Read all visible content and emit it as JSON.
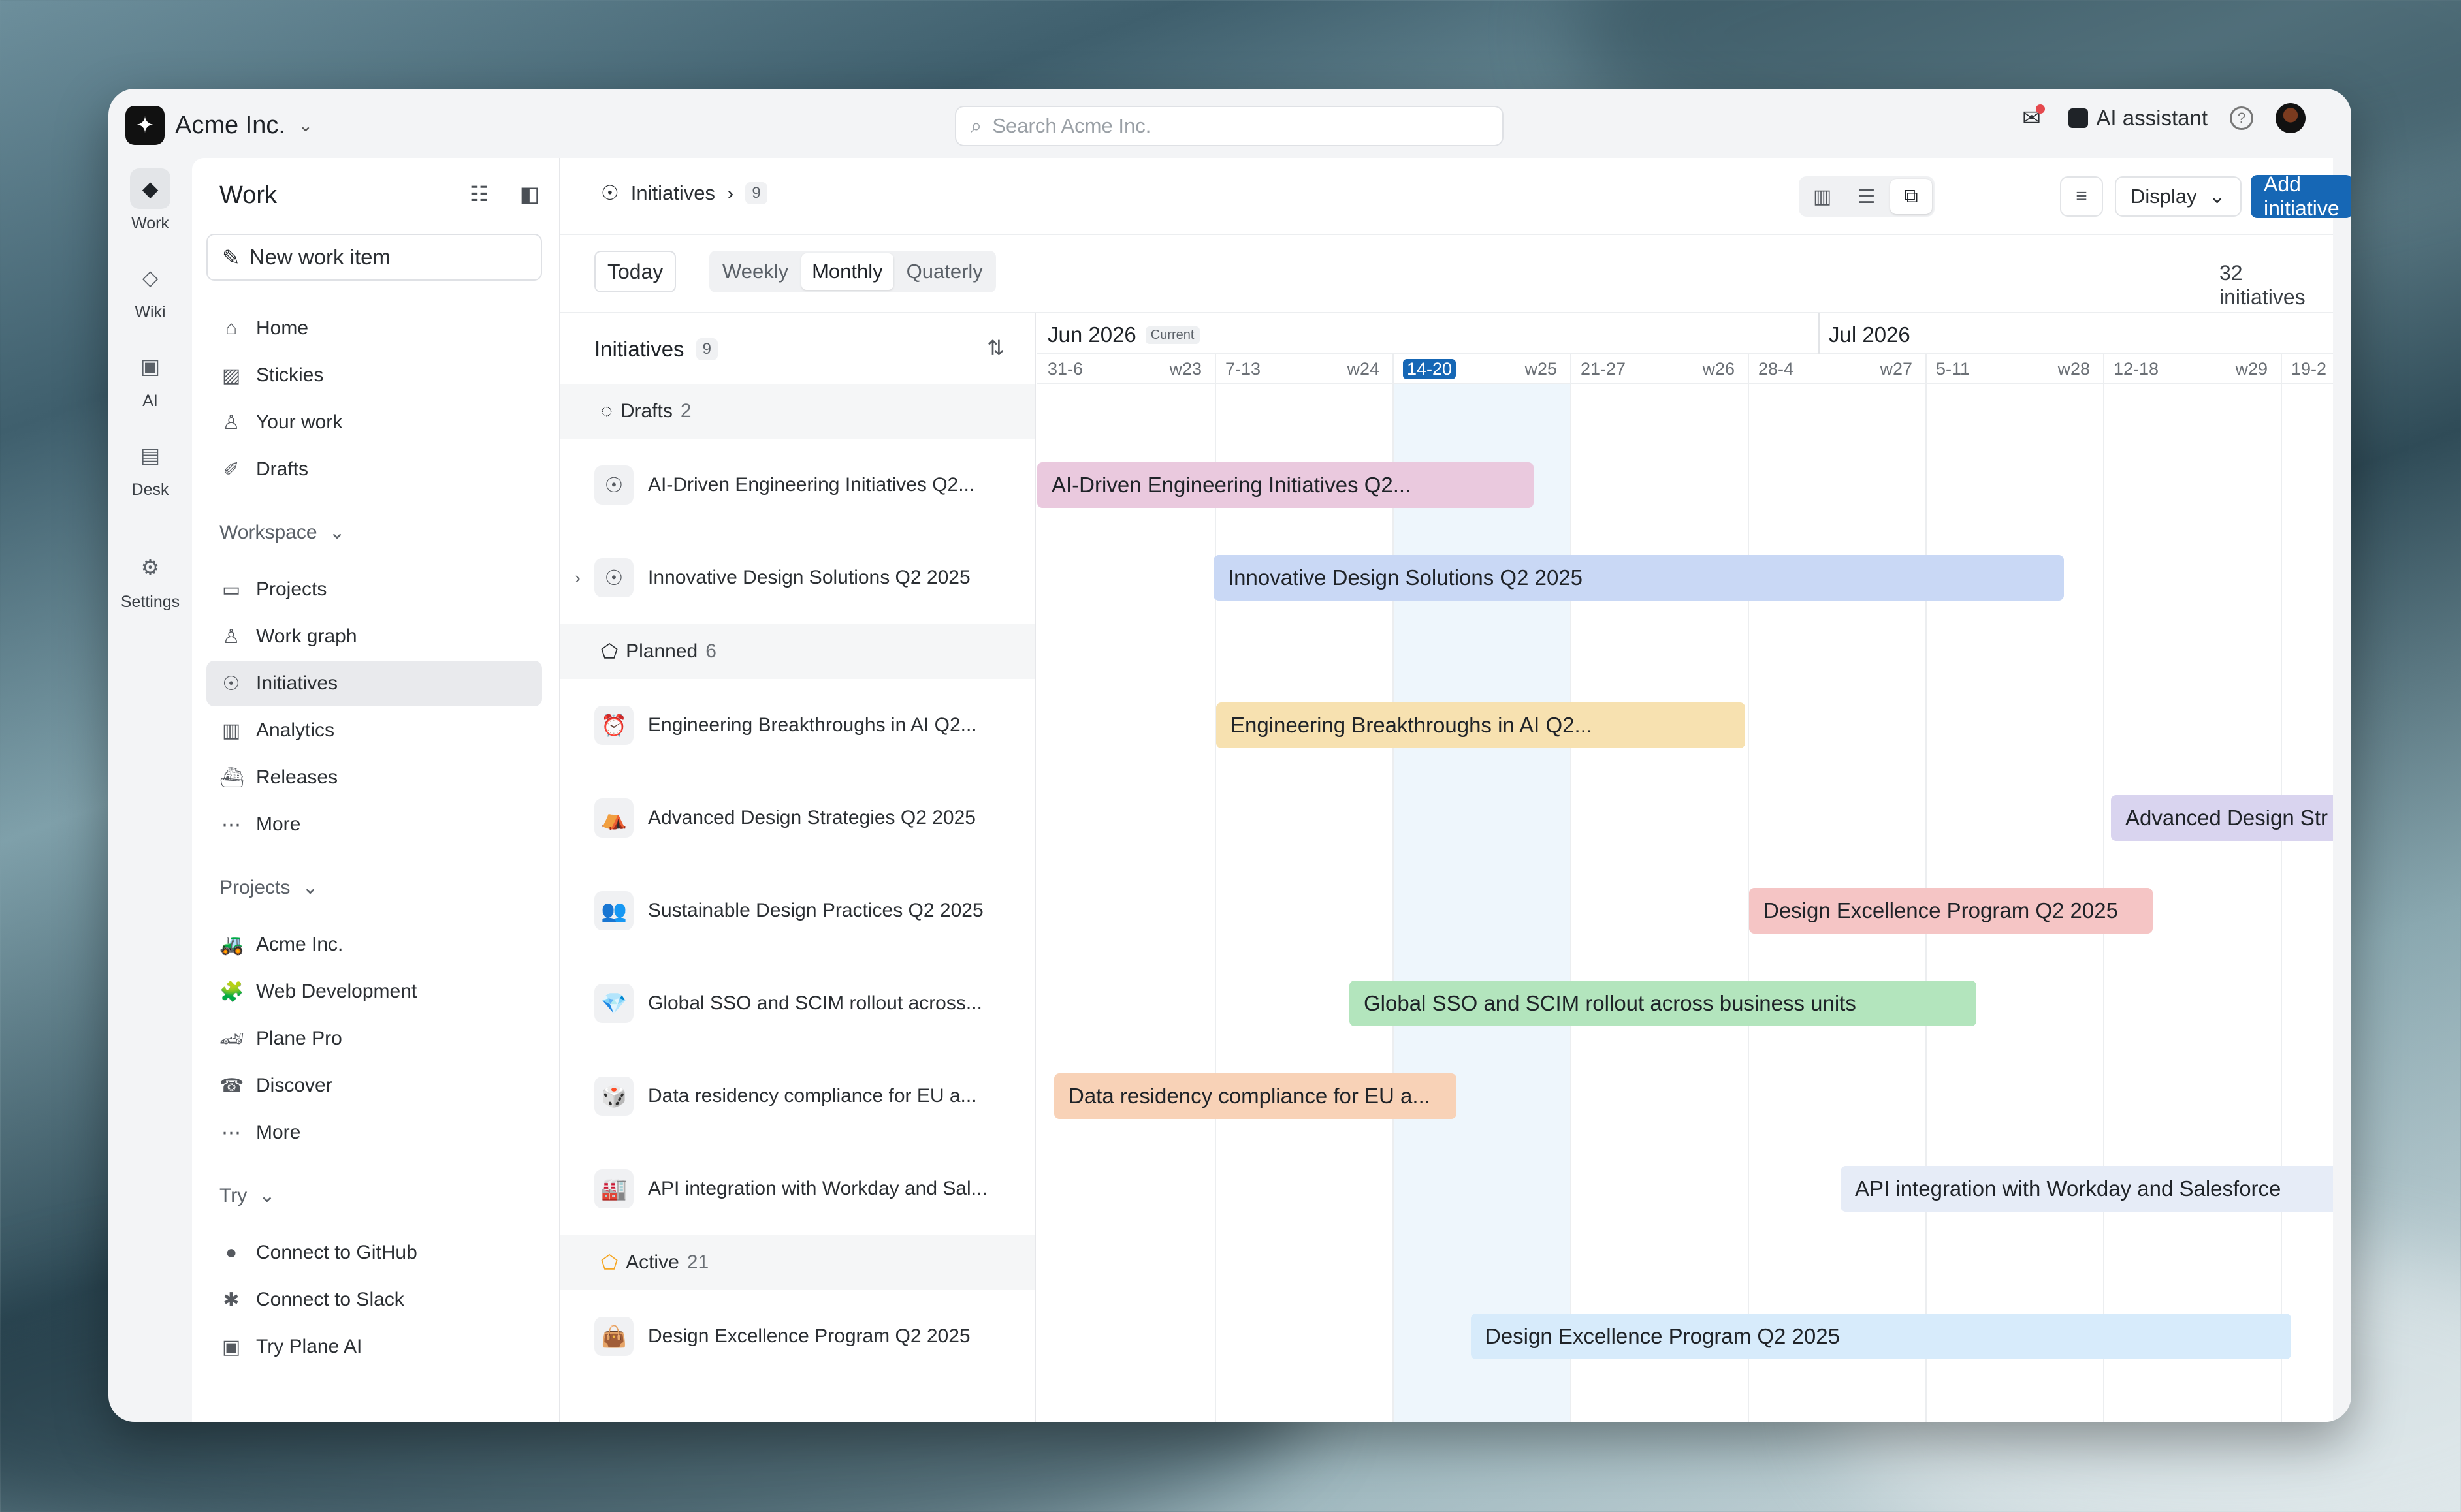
{
  "colors": {
    "accent": "#1667b5",
    "bar_pink": "#eac9de",
    "bar_blue": "#c9d8f5",
    "bar_yellow": "#f7e1b0",
    "bar_lavender": "#d9d4ef",
    "bar_red": "#f5c5c5",
    "bar_green": "#b3e5bd",
    "bar_orange": "#f8d2b7",
    "bar_sky": "#d7ebfb"
  },
  "workspace": {
    "name": "Acme Inc."
  },
  "search": {
    "placeholder": "Search Acme Inc."
  },
  "top_right": {
    "ai_assistant": "AI assistant"
  },
  "rail": [
    {
      "label": "Work",
      "icon": "work-icon"
    },
    {
      "label": "Wiki",
      "icon": "wiki-icon"
    },
    {
      "label": "AI",
      "icon": "ai-icon"
    },
    {
      "label": "Desk",
      "icon": "desk-icon"
    },
    {
      "label": "Settings",
      "icon": "gear-icon"
    }
  ],
  "sidebar": {
    "title": "Work",
    "new_item": "New work item",
    "main_nav": [
      "Home",
      "Stickies",
      "Your work",
      "Drafts"
    ],
    "workspace_header": "Workspace",
    "workspace_nav": [
      "Projects",
      "Work graph",
      "Initiatives",
      "Analytics",
      "Releases",
      "More"
    ],
    "projects_header": "Projects",
    "projects_nav": [
      "Acme Inc.",
      "Web Development",
      "Plane Pro",
      "Discover",
      "More"
    ],
    "try_header": "Try",
    "try_nav": [
      "Connect to GitHub",
      "Connect to Slack",
      "Try Plane AI"
    ]
  },
  "main": {
    "breadcrumb": "Initiatives",
    "breadcrumb_count": "9",
    "display_label": "Display",
    "add_button": "Add initiative",
    "today_label": "Today",
    "ranges": [
      "Weekly",
      "Monthly",
      "Quaterly"
    ],
    "active_range": "Monthly",
    "initiative_count": "32 initiatives"
  },
  "list": {
    "header": "Initiatives",
    "header_count": "9",
    "groups": [
      {
        "name": "Drafts",
        "count": "2"
      },
      {
        "name": "Planned",
        "count": "6"
      },
      {
        "name": "Active",
        "count": "21"
      }
    ],
    "items": [
      "AI-Driven Engineering Initiatives Q2...",
      "Innovative Design Solutions Q2 2025",
      "Engineering Breakthroughs in AI Q2...",
      "Advanced Design Strategies Q2 2025",
      "Sustainable Design Practices Q2 2025",
      "Global SSO and SCIM rollout across...",
      "Data residency compliance for EU a...",
      "API integration with Workday and Sal...",
      "Design Excellence Program Q2 2025"
    ]
  },
  "timeline": {
    "months": [
      "Jun 2026",
      "Jul 2026"
    ],
    "current_tag": "Current",
    "weeks": [
      {
        "range": "31-6",
        "week": "w23"
      },
      {
        "range": "7-13",
        "week": "w24"
      },
      {
        "range": "14-20",
        "week": "w25"
      },
      {
        "range": "21-27",
        "week": "w26"
      },
      {
        "range": "28-4",
        "week": "w27"
      },
      {
        "range": "5-11",
        "week": "w28"
      },
      {
        "range": "12-18",
        "week": "w29"
      },
      {
        "range": "19-2",
        "week": ""
      }
    ],
    "bars": [
      "AI-Driven Engineering Initiatives Q2...",
      "Innovative Design Solutions Q2 2025",
      "Engineering Breakthroughs in AI Q2...",
      "Advanced Design Str",
      "Design Excellence Program Q2 2025",
      "Global SSO and SCIM rollout across business units",
      "Data residency compliance for EU a...",
      "API integration with Workday and Salesforce",
      "Design Excellence Program Q2 2025"
    ]
  }
}
